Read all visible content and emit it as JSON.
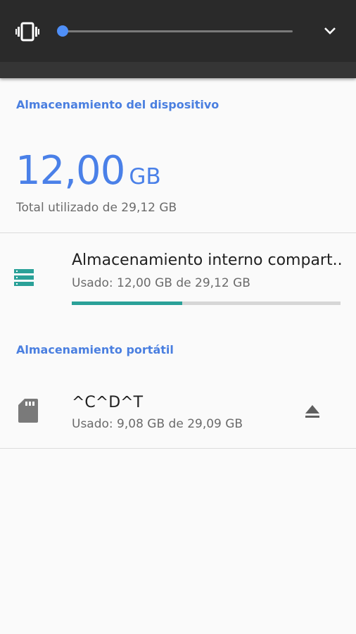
{
  "colors": {
    "accent_blue": "#4a80e8",
    "teal_icon": "#2aa198",
    "panel_dark": "#2a2a2a",
    "text_primary": "#212121",
    "text_secondary": "#6b6b6b"
  },
  "volume_panel": {
    "level": 0.0,
    "icons": [
      "vibrate-icon",
      "chevron-down-icon"
    ]
  },
  "device_storage": {
    "header": "Almacenamiento del dispositivo",
    "used_value": "12,00",
    "used_unit": "GB",
    "total_label": "Total utilizado de 29,12 GB"
  },
  "internal_storage": {
    "icon": "storage-icon",
    "title": "Almacenamiento interno compart..",
    "used": "Usado: 12,00 GB de 29,12 GB",
    "usage_fraction": 0.41
  },
  "portable_storage": {
    "header": "Almacenamiento portátil",
    "icon": "sd-card-icon",
    "title": "^C^D^T",
    "used": "Usado: 9,08 GB de 29,09 GB",
    "action_icon": "eject-icon"
  }
}
